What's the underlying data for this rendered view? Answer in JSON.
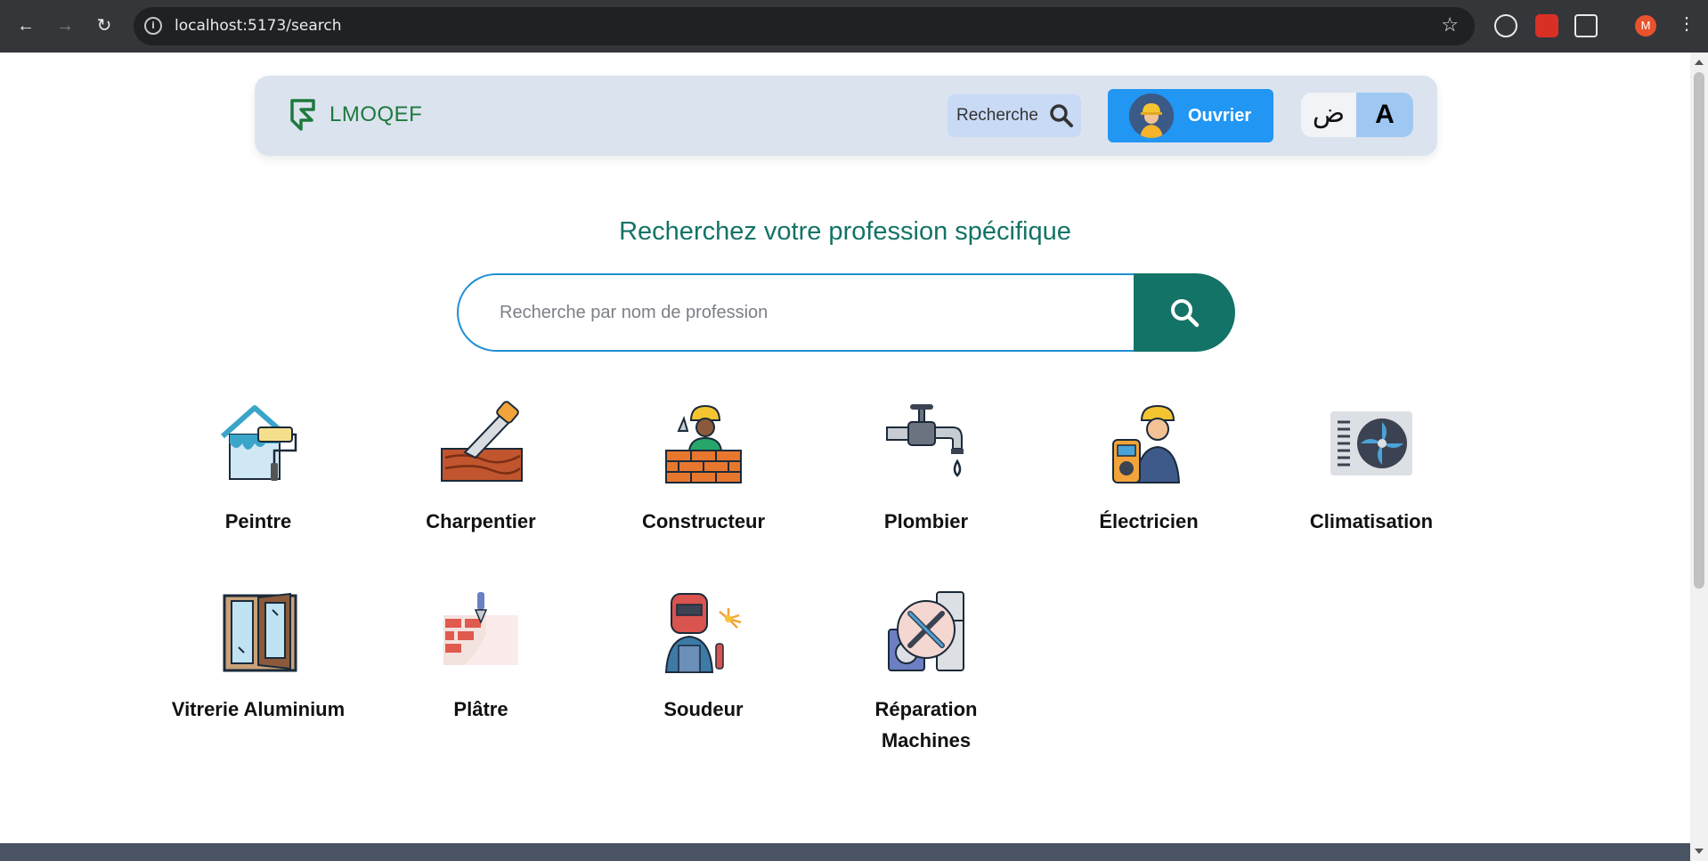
{
  "browser": {
    "url": "localhost:5173/search",
    "profile_initial": "M"
  },
  "navbar": {
    "brand": "LMOQEF",
    "search_label": "Recherche",
    "ouvrier_label": "Ouvrier",
    "lang_ar": "ض",
    "lang_fr": "A"
  },
  "main": {
    "headline": "Recherchez votre profession spécifique",
    "search_placeholder": "Recherche par nom de profession"
  },
  "professions": [
    {
      "label": "Peintre",
      "icon": "painter-house-icon"
    },
    {
      "label": "Charpentier",
      "icon": "saw-wood-icon"
    },
    {
      "label": "Constructeur",
      "icon": "bricklayer-icon"
    },
    {
      "label": "Plombier",
      "icon": "faucet-icon"
    },
    {
      "label": "Électricien",
      "icon": "electrician-icon"
    },
    {
      "label": "Climatisation",
      "icon": "air-conditioner-icon"
    },
    {
      "label": "Vitrerie Aluminium",
      "icon": "window-frame-icon"
    },
    {
      "label": "Plâtre",
      "icon": "plaster-wall-icon"
    },
    {
      "label": "Soudeur",
      "icon": "welder-icon"
    },
    {
      "label": "Réparation Machines",
      "icon": "appliance-repair-icon"
    }
  ],
  "colors": {
    "brand_green": "#1e7a3c",
    "teal": "#137366",
    "primary_blue": "#2196f3"
  }
}
